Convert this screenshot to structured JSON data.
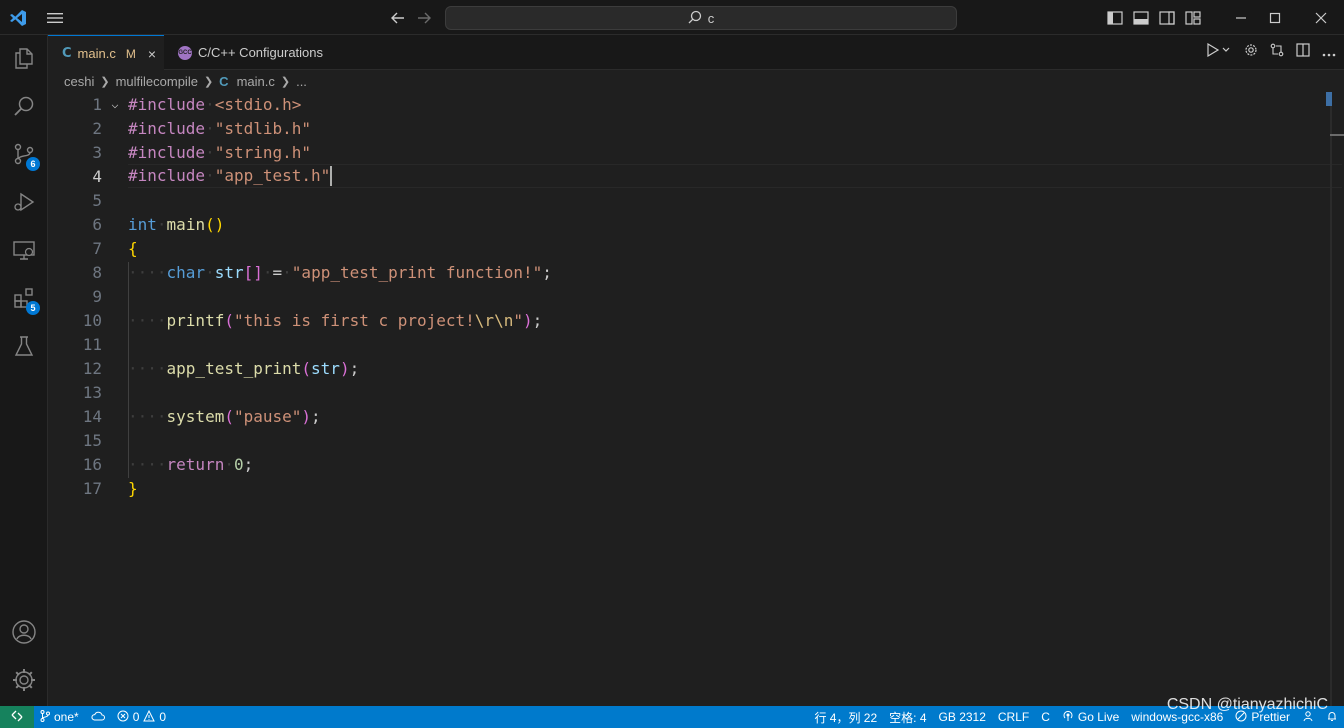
{
  "titlebar": {
    "search_text": "c",
    "icons": [
      "vscode-logo-icon",
      "menu-icon",
      "back-arrow-icon",
      "forward-arrow-icon",
      "search-icon",
      "toggle-primary-sidebar-icon",
      "toggle-panel-icon",
      "toggle-secondary-sidebar-icon",
      "customize-layout-icon",
      "minimize-icon",
      "maximize-icon",
      "close-icon"
    ]
  },
  "activitybar": {
    "items": [
      {
        "name": "explorer",
        "icon": "files-icon"
      },
      {
        "name": "search",
        "icon": "search-icon"
      },
      {
        "name": "source-control",
        "icon": "source-control-icon",
        "badge": "6"
      },
      {
        "name": "run-debug",
        "icon": "run-debug-icon"
      },
      {
        "name": "remote-explorer",
        "icon": "remote-explorer-icon"
      },
      {
        "name": "extensions",
        "icon": "extensions-icon",
        "badge": "5"
      },
      {
        "name": "testing",
        "icon": "beaker-icon"
      }
    ],
    "bottom": [
      {
        "name": "accounts",
        "icon": "account-icon"
      },
      {
        "name": "manage",
        "icon": "gear-icon"
      }
    ]
  },
  "tabs": [
    {
      "glyph": "C",
      "label": "main.c",
      "modified": "M",
      "close": "×",
      "active": true
    },
    {
      "glyph": "GCC",
      "label": "C/C++ Configurations",
      "active": false
    }
  ],
  "breadcrumb": {
    "parts": [
      "ceshi",
      "mulfilecompile"
    ],
    "file_glyph": "C",
    "file": "main.c",
    "tail": "..."
  },
  "editor": {
    "current_line": 4,
    "line_numbers": [
      "1",
      "2",
      "3",
      "4",
      "5",
      "6",
      "7",
      "8",
      "9",
      "10",
      "11",
      "12",
      "13",
      "14",
      "15",
      "16",
      "17"
    ],
    "tokens": {
      "inc": "#include",
      "h_stdio": "<stdio.h>",
      "h_stdlib": "\"stdlib.h\"",
      "h_string": "\"string.h\"",
      "h_app": "\"app_test.h\"",
      "int_kw": "int",
      "main_fn": "main",
      "char_kw": "char",
      "str_var": "str",
      "str_lit": "\"app_test_print function!\"",
      "printf_fn": "printf",
      "printf_lit_a": "\"this is first c project!",
      "esc_r": "\\r",
      "esc_n": "\\n",
      "quote": "\"",
      "app_fn": "app_test_print",
      "system_fn": "system",
      "pause_lit": "\"pause\"",
      "return_kw": "return",
      "zero": "0"
    }
  },
  "statusbar": {
    "branch": "one*",
    "errors": "0",
    "warnings": "0",
    "position": "行 4，列 22",
    "spaces": "空格: 4",
    "encoding": "GB 2312",
    "eol": "CRLF",
    "language": "C",
    "golive": "Go Live",
    "config": "windows-gcc-x86",
    "prettier": "Prettier"
  },
  "watermark": "CSDN @tianyazhichiC",
  "colors": {
    "accent": "#0078d4",
    "statusbar": "#007acc",
    "remote": "#16825d"
  }
}
